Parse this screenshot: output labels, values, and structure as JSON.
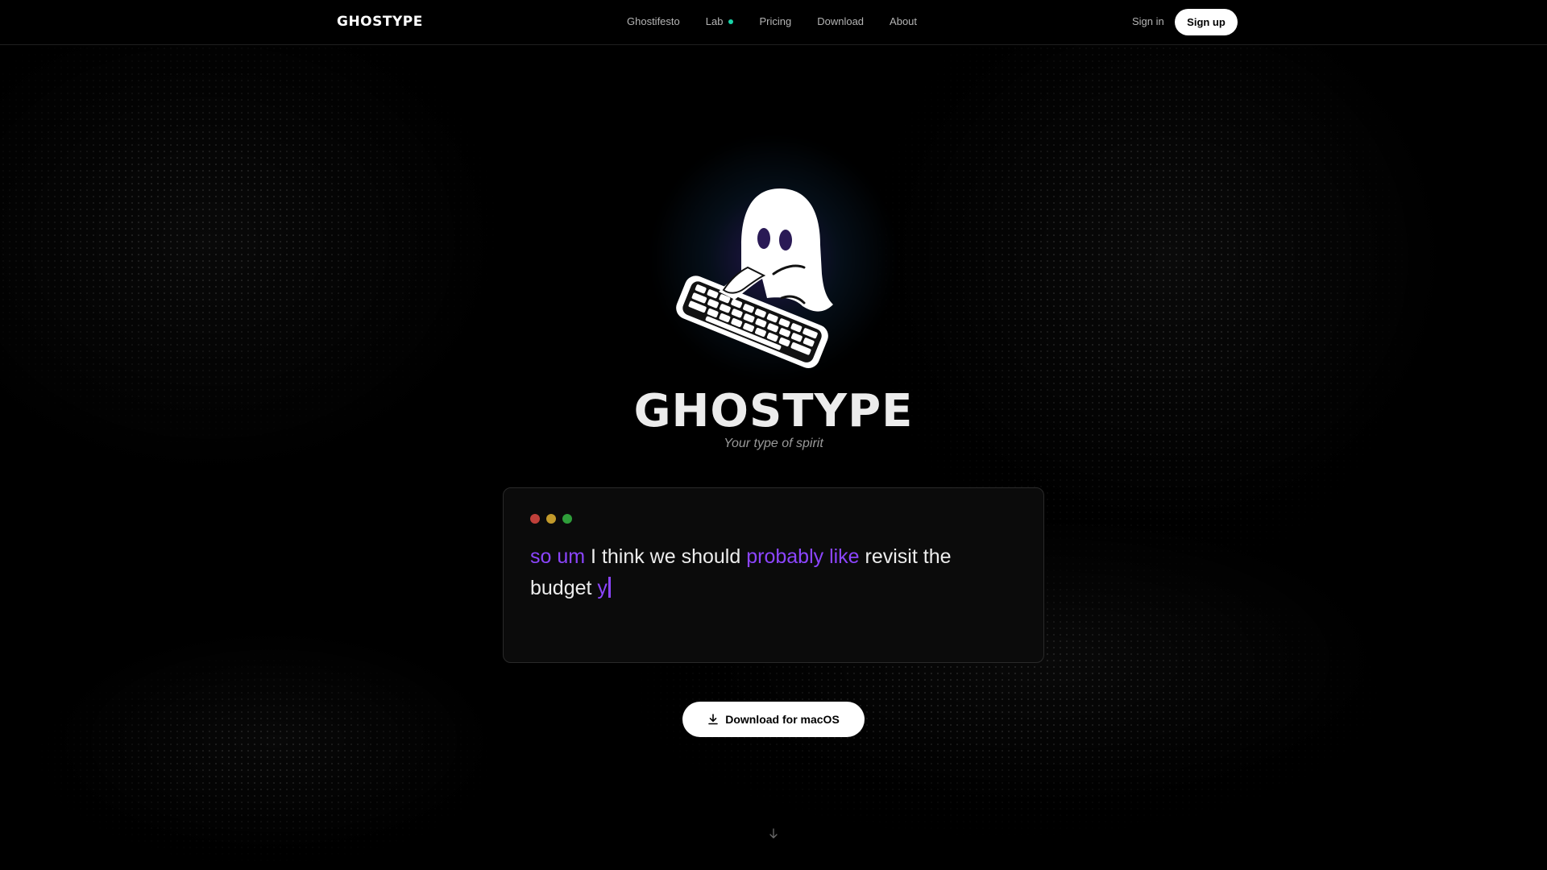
{
  "nav": {
    "brand": "GHOSTYPE",
    "links": [
      {
        "label": "Ghostifesto"
      },
      {
        "label": "Lab"
      },
      {
        "label": "Pricing"
      },
      {
        "label": "Download"
      },
      {
        "label": "About"
      }
    ],
    "sign_in": "Sign in",
    "sign_up": "Sign up"
  },
  "hero": {
    "title": "GHOSTYPE",
    "subtitle": "Your type of spirit"
  },
  "demo": {
    "segments": [
      {
        "text": "so um",
        "filler": true
      },
      {
        "text": " I think we should ",
        "filler": false
      },
      {
        "text": "probably like",
        "filler": true
      },
      {
        "text": " revisit the budget ",
        "filler": false
      },
      {
        "text": "y",
        "filler": true
      }
    ]
  },
  "cta": {
    "label": "Download for macOS"
  },
  "icons": {
    "lab_badge": "dot-indicator",
    "cta": "download-icon",
    "scroll": "arrow-down-icon"
  },
  "colors": {
    "background": "#000000",
    "accent_purple": "#8c45ff",
    "lab_dot": "#19d3a8",
    "traffic_red": "#c0403a",
    "traffic_yellow": "#c29a2b",
    "traffic_green": "#2f9e3a"
  }
}
